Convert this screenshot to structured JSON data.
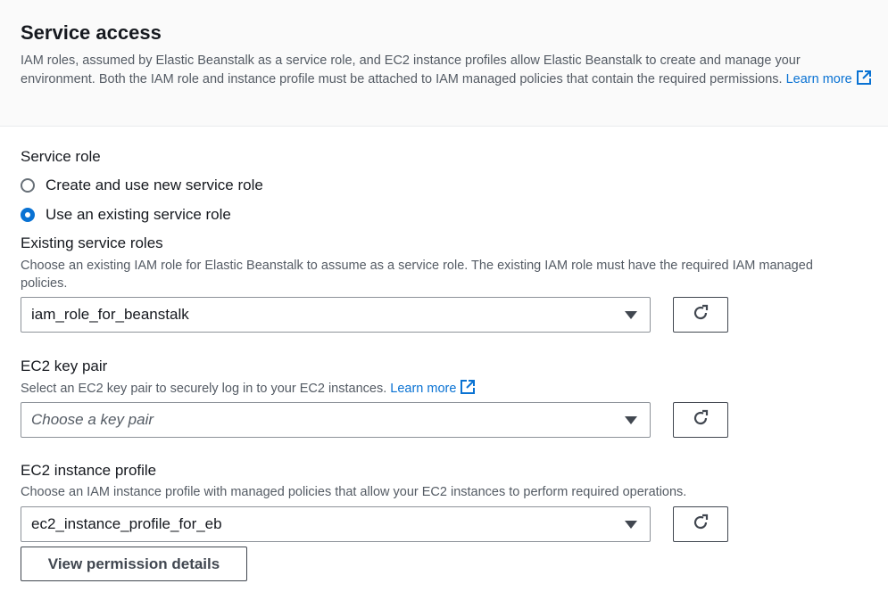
{
  "header": {
    "title": "Service access",
    "description": "IAM roles, assumed by Elastic Beanstalk as a service role, and EC2 instance profiles allow Elastic Beanstalk to create and manage your environment. Both the IAM role and instance profile must be attached to IAM managed policies that contain the required permissions.",
    "learn_more": "Learn more"
  },
  "service_role": {
    "label": "Service role",
    "options": [
      {
        "label": "Create and use new service role",
        "selected": false
      },
      {
        "label": "Use an existing service role",
        "selected": true
      }
    ]
  },
  "existing_roles": {
    "label": "Existing service roles",
    "hint": "Choose an existing IAM role for Elastic Beanstalk to assume as a service role. The existing IAM role must have the required IAM managed policies.",
    "value": "iam_role_for_beanstalk"
  },
  "key_pair": {
    "label": "EC2 key pair",
    "hint": "Select an EC2 key pair to securely log in to your EC2 instances.",
    "learn_more": "Learn more",
    "placeholder": "Choose a key pair"
  },
  "instance_profile": {
    "label": "EC2 instance profile",
    "hint": "Choose an IAM instance profile with managed policies that allow your EC2 instances to perform required operations.",
    "value": "ec2_instance_profile_for_eb"
  },
  "view_permissions_button": "View permission details",
  "icons": {
    "external": "external-link-icon",
    "refresh": "refresh-icon",
    "caret": "caret-down-icon"
  },
  "colors": {
    "link": "#0972d3",
    "radio_selected": "#0972d3",
    "header_bg": "#fafafa"
  }
}
